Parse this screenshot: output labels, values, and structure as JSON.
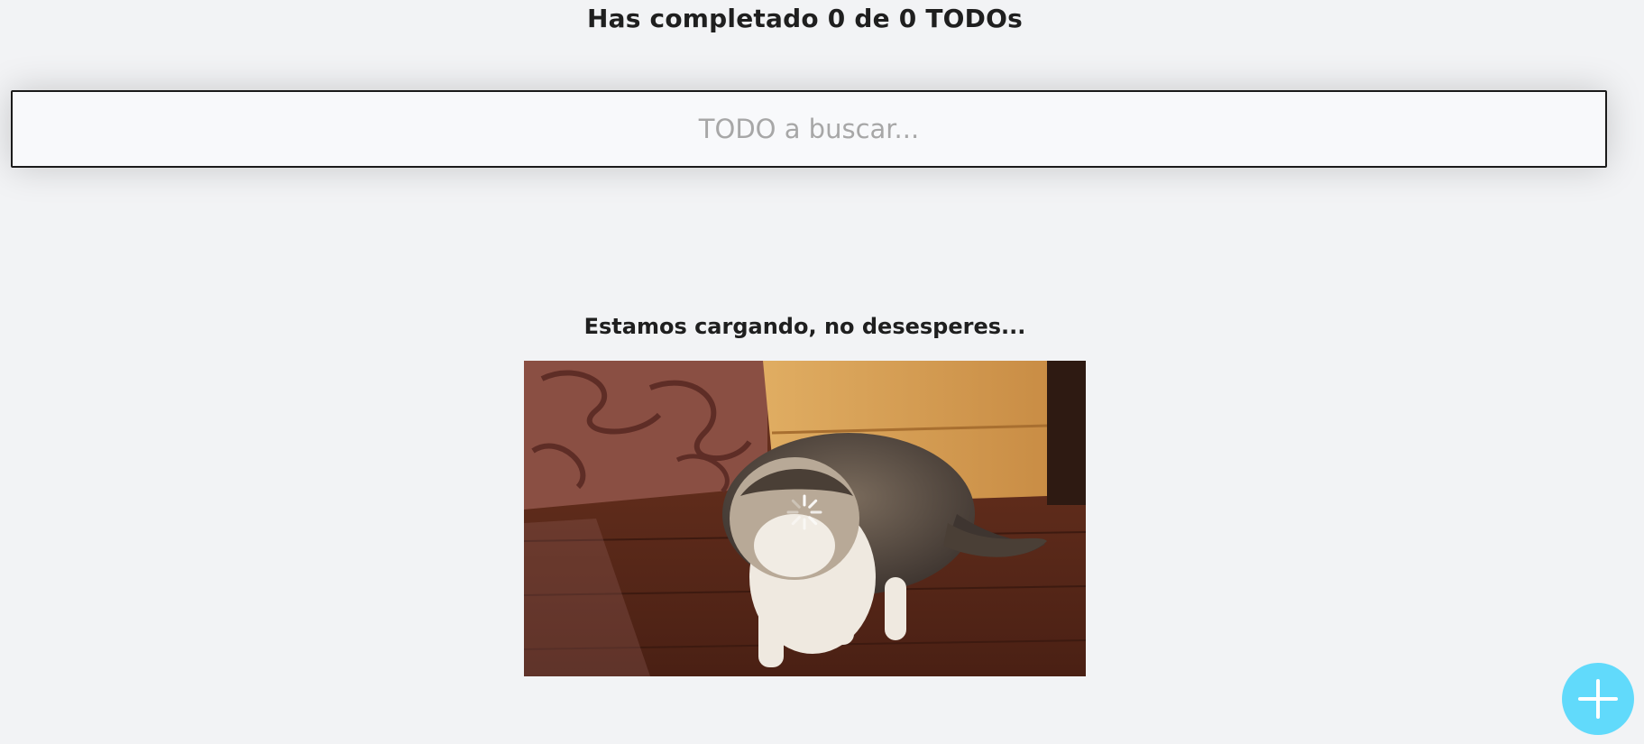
{
  "header": {
    "counter_text": "Has completado 0 de 0 TODOs"
  },
  "search": {
    "placeholder": "TODO a buscar...",
    "value": ""
  },
  "loading": {
    "message": "Estamos cargando, no desesperes...",
    "image_icon": "loading-cat-image",
    "spinner_icon": "spinner-icon"
  },
  "fab": {
    "icon": "plus-icon",
    "color": "#61dafb"
  },
  "colors": {
    "background": "#f2f3f5",
    "accent": "#61dafb",
    "text": "#1f1f1f"
  }
}
